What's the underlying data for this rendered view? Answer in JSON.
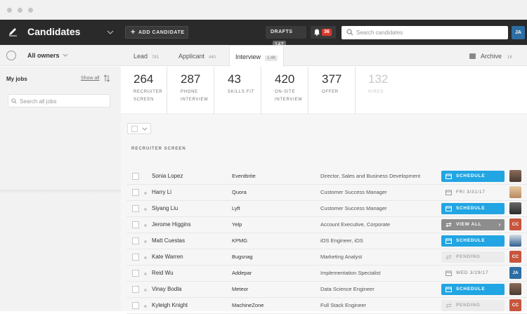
{
  "header": {
    "title": "Candidates",
    "add_candidate": "ADD CANDIDATE",
    "drafts_label": "DRAFTS",
    "drafts_count": "147",
    "notifications_count": "36",
    "search_placeholder": "Search candidates",
    "user_initials": "JA"
  },
  "sidebar": {
    "owners": "All owners",
    "my_jobs": "My jobs",
    "show_all": "Show all",
    "search_placeholder": "Search all jobs"
  },
  "tabs": [
    {
      "label": "Lead",
      "count": "781"
    },
    {
      "label": "Applicant",
      "count": "440"
    },
    {
      "label": "Interview",
      "count": "1.4K"
    }
  ],
  "archive": {
    "label": "Archive",
    "count": "1K"
  },
  "stages": [
    {
      "num": "264",
      "label": "RECRUITER SCREEN"
    },
    {
      "num": "287",
      "label": "PHONE INTERVIEW"
    },
    {
      "num": "43",
      "label": "SKILLS FIT"
    },
    {
      "num": "420",
      "label": "ON-SITE INTERVIEW"
    },
    {
      "num": "377",
      "label": "OFFER"
    },
    {
      "num": "132",
      "label": "HIRED"
    }
  ],
  "section_title": "RECRUITER SCREEN",
  "rows": [
    {
      "name": "Sonia Lopez",
      "company": "Eventbrite",
      "title": "Director, Sales and Business Development",
      "action": "SCHEDULE",
      "initials": ""
    },
    {
      "name": "Harry Li",
      "company": "Quora",
      "title": "Customer Success Manager",
      "action": "FRI 3/31/17",
      "initials": ""
    },
    {
      "name": "Siyang Liu",
      "company": "Lyft",
      "title": "Customer Success Manager",
      "action": "SCHEDULE",
      "initials": ""
    },
    {
      "name": "Jerome Higgins",
      "company": "Yelp",
      "title": "Account Executive, Corporate",
      "action": "VIEW ALL",
      "initials": "CC"
    },
    {
      "name": "Matt Cuestas",
      "company": "KPMG",
      "title": "iOS Engineer, iOS",
      "action": "SCHEDULE",
      "initials": ""
    },
    {
      "name": "Kate Warren",
      "company": "Bugsnag",
      "title": "Marketing Analyst",
      "action": "PENDING",
      "initials": "CC"
    },
    {
      "name": "Reid Wu",
      "company": "Addepar",
      "title": "Implementation Specialist",
      "action": "WED 3/29/17",
      "initials": "JA"
    },
    {
      "name": "Vinay Bodla",
      "company": "Meteor",
      "title": "Data Science Engineer",
      "action": "SCHEDULE",
      "initials": ""
    },
    {
      "name": "Kyleigh Knight",
      "company": "MachineZone",
      "title": "Full Stack Engineer",
      "action": "PENDING",
      "initials": "CC"
    }
  ],
  "colors": {
    "topbar": "#2a2a2a",
    "schedule": "#21a5e3",
    "alert": "#d9382b",
    "cc_badge": "#c8553d",
    "ja_badge": "#2d6ea3"
  }
}
